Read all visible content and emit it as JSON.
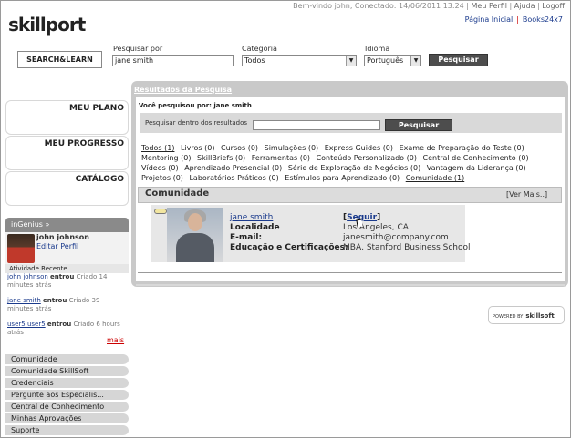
{
  "header": {
    "logo": "skillport",
    "welcome": "Bem-vindo john, Conectado: 14/06/2011 13:24",
    "links": [
      "Meu Perfil",
      "Ajuda",
      "Logoff"
    ],
    "subnav": [
      "Página Inicial",
      "Books24x7"
    ]
  },
  "search": {
    "brand": "SEARCH&LEARN",
    "search_label": "Pesquisar por",
    "search_value": "jane smith",
    "category_label": "Categoria",
    "category_value": "Todos",
    "language_label": "Idioma",
    "language_value": "Português",
    "button": "Pesquisar"
  },
  "left_menu": {
    "items": [
      "MEU PLANO",
      "MEU PROGRESSO",
      "CATÁLOGO"
    ]
  },
  "ingenius": {
    "title": "inGenius",
    "user_name": "john johnson",
    "edit_profile": "Editar Perfil",
    "activity_header": "Atividade Recente",
    "activities": [
      {
        "user": "john johnson",
        "action": "entrou",
        "time": "Criado 14 minutes atrás"
      },
      {
        "user": "jane smith",
        "action": "entrou",
        "time": "Criado 39 minutes atrás"
      },
      {
        "user": "user5 user5",
        "action": "entrou",
        "time": "Criado 6 hours atrás"
      }
    ],
    "more": "mais"
  },
  "left_nav": [
    "Comunidade",
    "Comunidade SkillSoft",
    "Credenciais",
    "Pergunte aos Especialis...",
    "Central de Conhecimento",
    "Minhas Aprovações",
    "Suporte"
  ],
  "results": {
    "title": "Resultados da Pesquisa",
    "searched_for": "Você pesquisou por: jane smith",
    "within_label": "Pesquisar dentro dos resultados",
    "within_button": "Pesquisar",
    "filters": [
      "Todos (1)",
      "Livros (0)",
      "Cursos (0)",
      "Simulações (0)",
      "Express Guides (0)",
      "Exame de Preparação do Teste (0)",
      "Mentoring (0)",
      "SkillBriefs (0)",
      "Ferramentas (0)",
      "Conteúdo Personalizado (0)",
      "Central de Conhecimento (0)",
      "Vídeos (0)",
      "Aprendizado Presencial (0)",
      "Série de Exploração de Negócios (0)",
      "Vantagem da Liderança (0)",
      "Projetos (0)",
      "Laboratórios Práticos (0)",
      "Estímulos para Aprendizado (0)",
      "Comunidade (1)"
    ],
    "community_title": "Comunidade",
    "see_more": "[Ver Mais..]",
    "person": {
      "name": "jane smith",
      "follow": "Seguir",
      "location_label": "Localidade",
      "location_value": "Los Angeles, CA",
      "email_label": "E-mail:",
      "email_value": "janesmith@company.com",
      "education_label": "Educação e Certificações:",
      "education_value": "MBA, Stanford Business School"
    }
  },
  "powered_by": {
    "prefix": "POWERED BY",
    "brand": "skillsoft"
  }
}
